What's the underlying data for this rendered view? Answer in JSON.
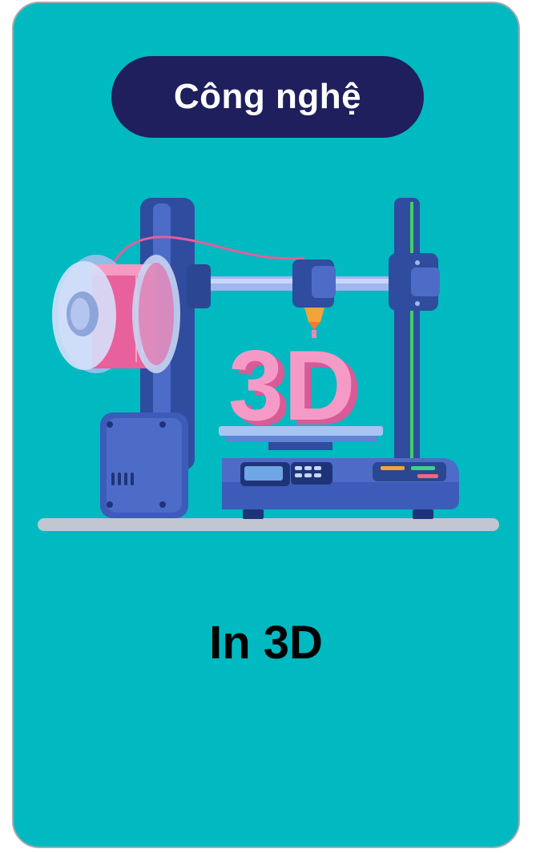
{
  "card": {
    "category": "Công nghệ",
    "title": "In 3D",
    "illustration_icon": "3d-printer-icon",
    "model_text": "3D",
    "colors": {
      "card_background": "#01b9c1",
      "card_border": "#a9a9ad",
      "pill_background": "#1e1f5c",
      "pill_text": "#ffffff",
      "title_text": "#000000",
      "printer_blue": "#3d5bb8",
      "filament_pink": "#e8609c",
      "model_pink": "#f287ba"
    }
  }
}
